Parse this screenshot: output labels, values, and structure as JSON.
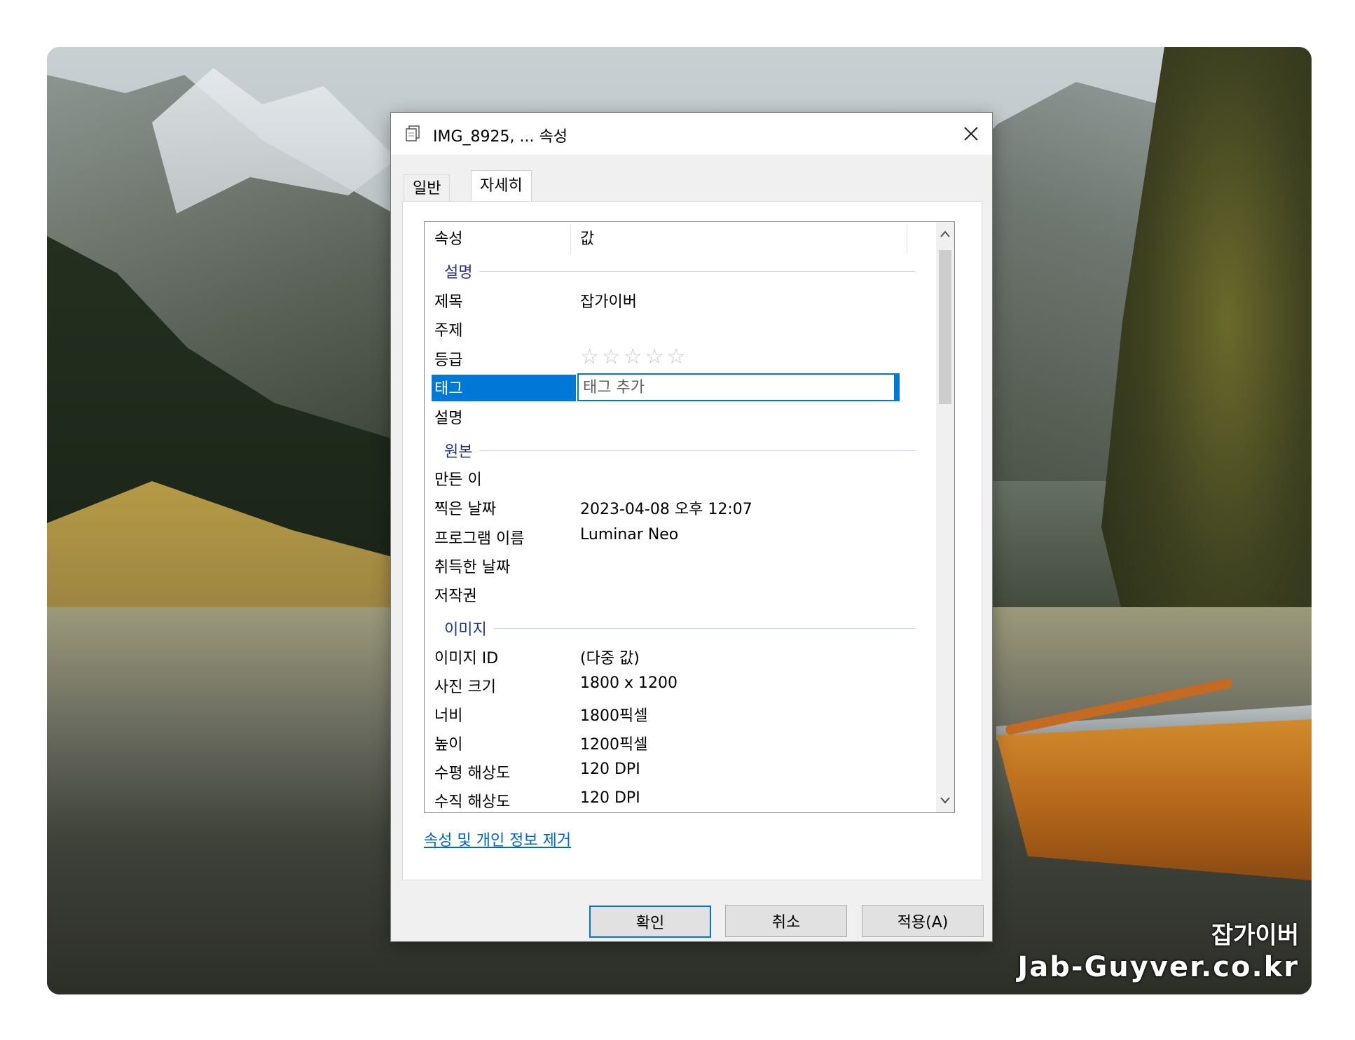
{
  "window": {
    "title": "IMG_8925, ... 속성",
    "close_icon": "close-icon",
    "title_icon": "file-copy-icon"
  },
  "tabs": [
    {
      "label": "일반",
      "active": false
    },
    {
      "label": "자세히",
      "active": true
    }
  ],
  "list": {
    "headers": {
      "property": "속성",
      "value": "값"
    },
    "groups": {
      "description": "설명",
      "origin": "원본",
      "image": "이미지"
    },
    "rows": {
      "title": {
        "name": "제목",
        "value": "잡가이버"
      },
      "subject": {
        "name": "주제",
        "value": ""
      },
      "rating": {
        "name": "등급",
        "value": "☆☆☆☆☆",
        "stars_filled": 0,
        "stars_total": 5
      },
      "tags": {
        "name": "태그",
        "placeholder": "태그 추가",
        "value": ""
      },
      "comments": {
        "name": "설명",
        "value": ""
      },
      "authors": {
        "name": "만든 이",
        "value": ""
      },
      "date_taken": {
        "name": "찍은 날짜",
        "value": "2023-04-08 오후 12:07"
      },
      "program": {
        "name": "프로그램 이름",
        "value": "Luminar Neo"
      },
      "date_acquired": {
        "name": "취득한 날짜",
        "value": ""
      },
      "copyright": {
        "name": "저작권",
        "value": ""
      },
      "image_id": {
        "name": "이미지 ID",
        "value": "(다중 값)"
      },
      "dimensions": {
        "name": "사진 크기",
        "value": "1800 x 1200"
      },
      "width": {
        "name": "너비",
        "value": "1800픽셀"
      },
      "height": {
        "name": "높이",
        "value": "1200픽셀"
      },
      "h_res": {
        "name": "수평 해상도",
        "value": "120 DPI"
      },
      "v_res": {
        "name": "수직 해상도",
        "value": "120 DPI"
      }
    }
  },
  "link": {
    "remove_properties": "속성 및 개인 정보 제거"
  },
  "buttons": {
    "ok": "확인",
    "cancel": "취소",
    "apply": "적용(A)"
  },
  "watermark": {
    "line1": "잡가이버",
    "line2": "Jab-Guyver.co.kr"
  },
  "colors": {
    "accent": "#0078d7",
    "group_label": "#1e3287",
    "link": "#0066cc"
  }
}
